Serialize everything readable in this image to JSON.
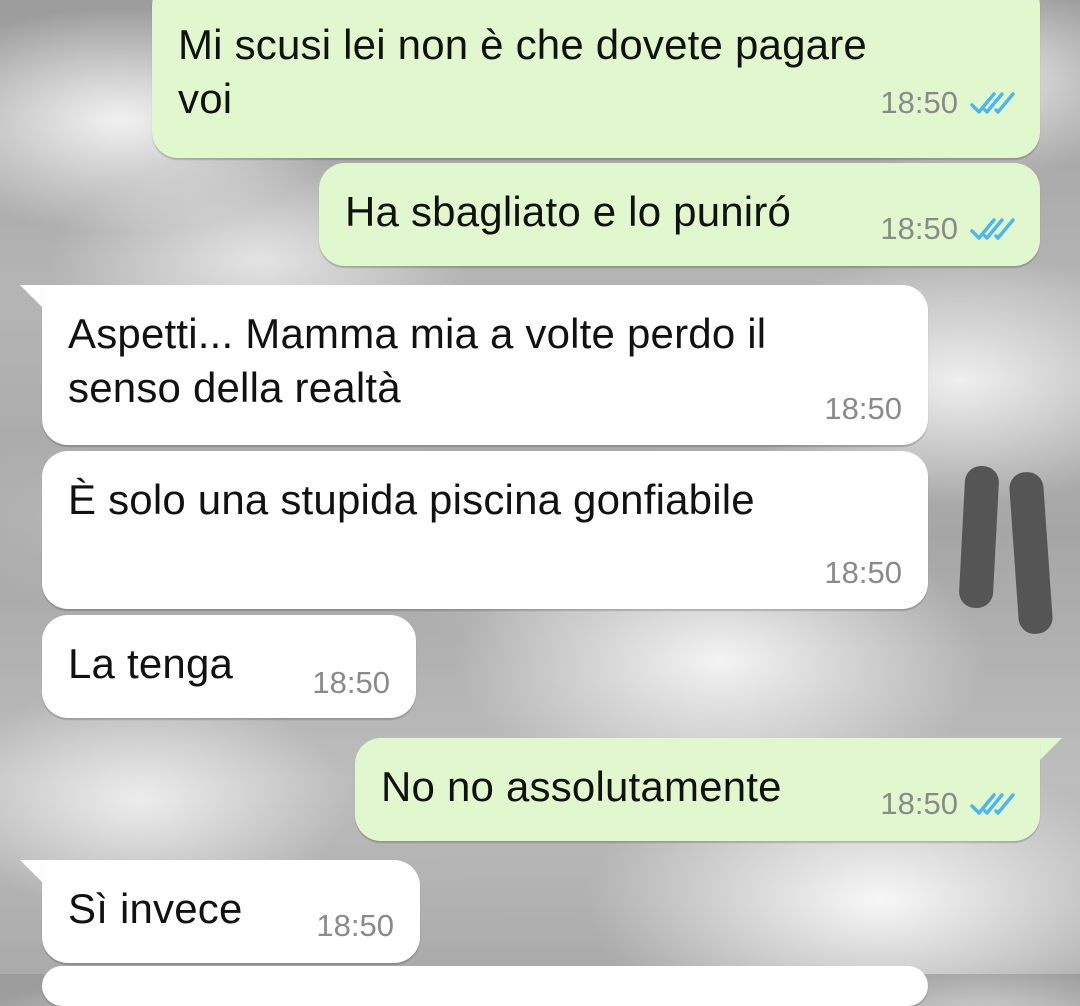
{
  "colors": {
    "outgoing_bubble": "#e1f8cf",
    "incoming_bubble": "#ffffff",
    "read_ticks": "#4fb6ec",
    "timestamp": "#8a8a8a",
    "redaction": "#555555"
  },
  "messages": [
    {
      "direction": "outgoing",
      "text": "Mi scusi lei non è che dovete pagare\nvoi",
      "time": "18:50",
      "status_icon": "double-check-read-icon"
    },
    {
      "direction": "outgoing",
      "text": "Ha sbagliato e lo puniró",
      "time": "18:50",
      "status_icon": "double-check-read-icon"
    },
    {
      "direction": "incoming",
      "text": "Aspetti... Mamma mia a volte perdo il\nsenso della realtà",
      "time": "18:50"
    },
    {
      "direction": "incoming",
      "text": "È solo una stupida piscina gonfiabile",
      "time": "18:50"
    },
    {
      "direction": "incoming",
      "text": "La tenga",
      "time": "18:50"
    },
    {
      "direction": "outgoing",
      "text": "No no assolutamente",
      "time": "18:50",
      "status_icon": "double-check-read-icon"
    },
    {
      "direction": "incoming",
      "text": "Sì invece",
      "time": "18:50"
    }
  ]
}
